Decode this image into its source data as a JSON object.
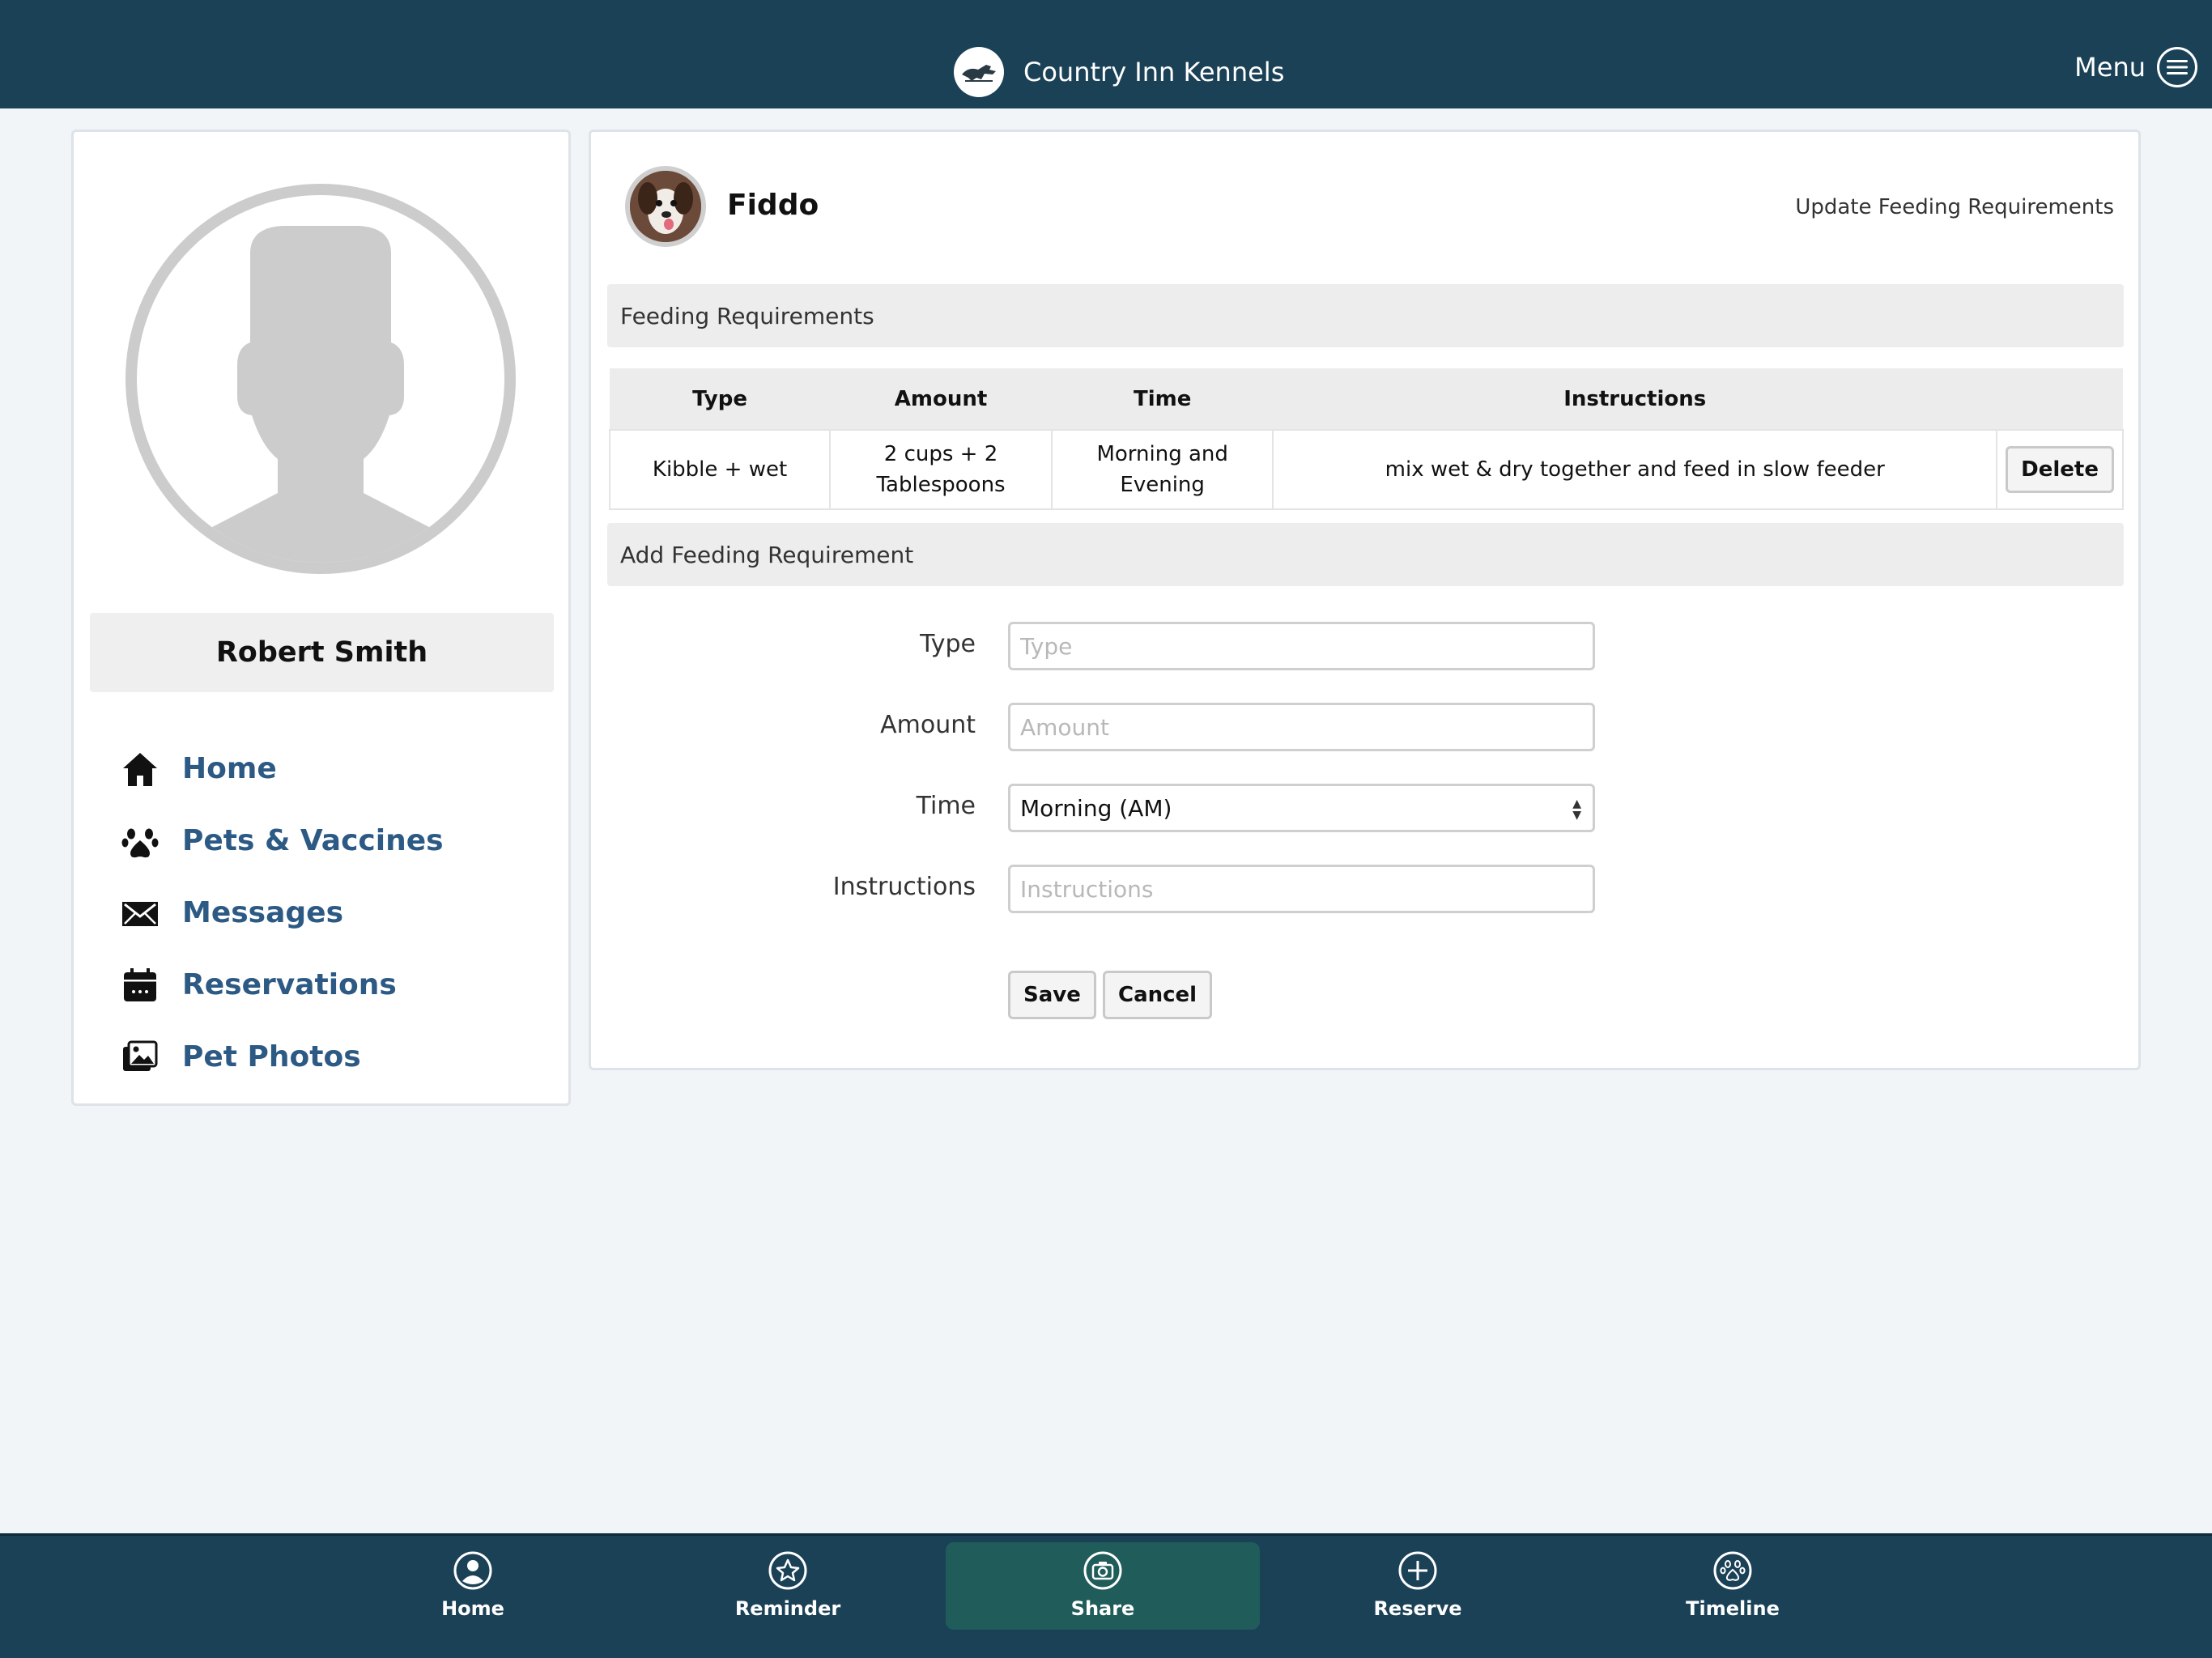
{
  "header": {
    "title": "Country Inn Kennels",
    "menu_label": "Menu"
  },
  "profile": {
    "name": "Robert Smith"
  },
  "nav": {
    "items": [
      {
        "label": "Home",
        "icon": "home-icon"
      },
      {
        "label": "Pets & Vaccines",
        "icon": "paw-icon"
      },
      {
        "label": "Messages",
        "icon": "envelope-icon"
      },
      {
        "label": "Reservations",
        "icon": "calendar-icon"
      },
      {
        "label": "Pet Photos",
        "icon": "photos-icon"
      }
    ]
  },
  "pet": {
    "name": "Fiddo",
    "update_link": "Update Feeding Requirements"
  },
  "feeding": {
    "section_title": "Feeding Requirements",
    "columns": [
      "Type",
      "Amount",
      "Time",
      "Instructions"
    ],
    "rows": [
      {
        "type": "Kibble + wet",
        "amount_line1": "2 cups + 2",
        "amount_line2": "Tablespoons",
        "time": "Morning and Evening",
        "instructions": "mix wet & dry together and feed in slow feeder",
        "action": "Delete"
      }
    ]
  },
  "add_form": {
    "section_title": "Add Feeding Requirement",
    "type_label": "Type",
    "type_placeholder": "Type",
    "amount_label": "Amount",
    "amount_placeholder": "Amount",
    "time_label": "Time",
    "time_value": "Morning (AM)",
    "instructions_label": "Instructions",
    "instructions_placeholder": "Instructions",
    "save_label": "Save",
    "cancel_label": "Cancel"
  },
  "tabbar": {
    "tabs": [
      {
        "label": "Home",
        "icon": "user-circle-icon"
      },
      {
        "label": "Reminder",
        "icon": "star-icon"
      },
      {
        "label": "Share",
        "icon": "camera-icon",
        "active": true
      },
      {
        "label": "Reserve",
        "icon": "plus-circle-icon"
      },
      {
        "label": "Timeline",
        "icon": "paw-circle-icon"
      }
    ]
  },
  "colors": {
    "header_bg": "#1b4157",
    "nav_link": "#2d5a84",
    "active_tab": "#1f5c5a",
    "page_bg": "#f1f5f8"
  }
}
